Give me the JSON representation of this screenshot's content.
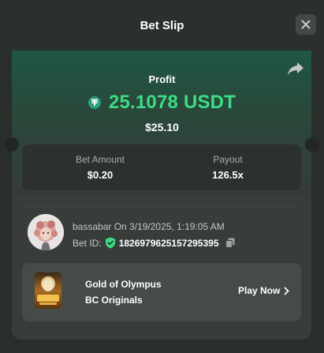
{
  "header": {
    "title": "Bet Slip",
    "close_icon": "close-icon"
  },
  "profit": {
    "label": "Profit",
    "value": "25.1078 USDT",
    "usd": "$25.10",
    "coin_icon": "tether-icon",
    "accent_color": "#3ddc84"
  },
  "stats": {
    "bet_amount": {
      "label": "Bet Amount",
      "value": "$0.20"
    },
    "payout": {
      "label": "Payout",
      "value": "126.5x"
    }
  },
  "bet": {
    "user_line": "bassabar On 3/19/2025, 1:19:05 AM",
    "bet_id_label": "Bet ID:",
    "bet_id": "1826979625157295395",
    "verified_icon": "shield-check-icon",
    "copy_icon": "copy-icon"
  },
  "game": {
    "name": "Gold of Olympus",
    "provider": "BC Originals",
    "action": "Play Now",
    "thumb_icon": "game-thumbnail",
    "arrow_icon": "chevron-right-icon"
  },
  "share_icon": "share-icon"
}
